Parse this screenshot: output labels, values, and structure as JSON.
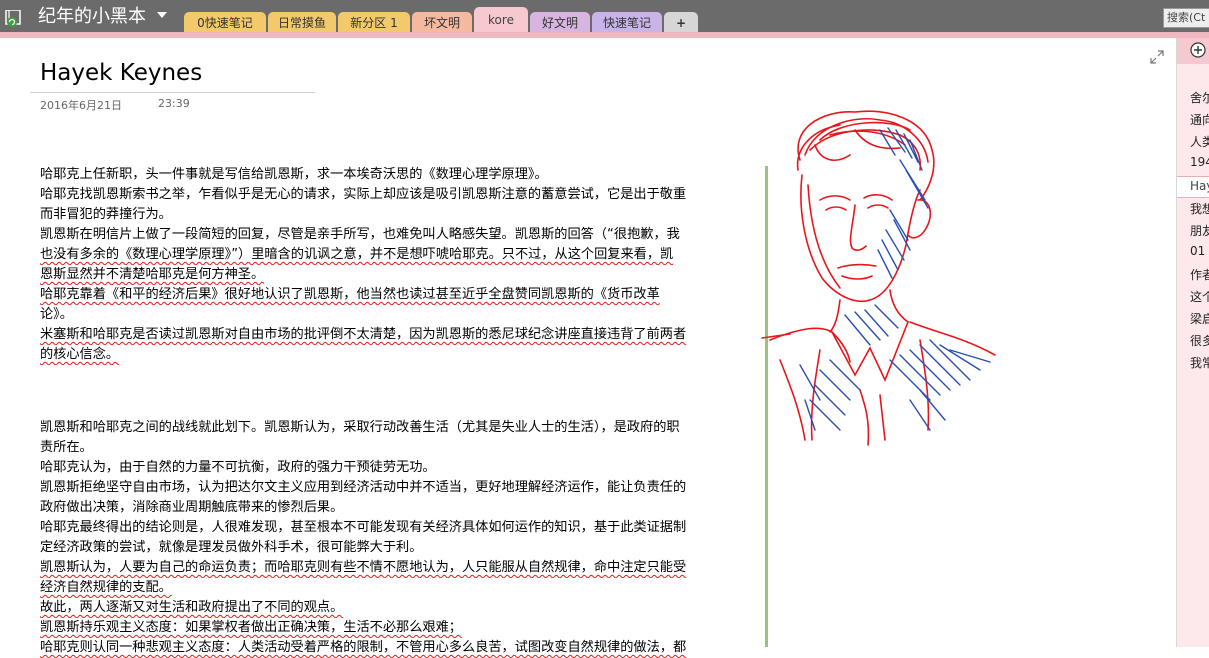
{
  "notebook": {
    "title": "纪年的小黑本"
  },
  "tabs": [
    {
      "label": "0快速笔记",
      "color": "#f2c96b"
    },
    {
      "label": "日常摸鱼",
      "color": "#f2c96b"
    },
    {
      "label": "新分区 1",
      "color": "#f2c96b"
    },
    {
      "label": "坏文明",
      "color": "#f5b9a0"
    },
    {
      "label": "kore",
      "color": "#f5c9cf",
      "active": true
    },
    {
      "label": "好文明",
      "color": "#d8b4e0"
    },
    {
      "label": "快速笔记",
      "color": "#c8b4e6"
    },
    {
      "label": "+",
      "color": "#d6d6d6"
    }
  ],
  "search": {
    "placeholder": "搜索(Ct"
  },
  "page": {
    "title": "Hayek Keynes",
    "date": "2016年6月21日",
    "time": "23:39"
  },
  "content": [
    {
      "text": "哈耶克上任新职，头一件事就是写信给凯恩斯，求一本埃奇沃思的《数理心理学原理》。",
      "squiggle": false
    },
    {
      "text": "哈耶克找凯恩斯索书之举，乍看似乎是无心的请求，实际上却应该是吸引凯恩斯注意的蓄意尝试，它是出于敬重",
      "squiggle": false
    },
    {
      "text": "而非冒犯的莽撞行为。",
      "squiggle": false
    },
    {
      "text": "凯恩斯在明信片上做了一段简短的回复，尽管是亲手所写，也难免叫人略感失望。凯恩斯的回答（“很抱歉，我",
      "squiggle": false
    },
    {
      "text": "也没有多余的《数理心理学原理》”）里暗含的讥讽之意，并不是想吓唬哈耶克。只不过，从这个回复来看，凯",
      "squiggle": true
    },
    {
      "text": "恩斯显然并不清楚哈耶克是何方神圣。",
      "squiggle": true
    },
    {
      "text": "哈耶克靠着《和平的经济后果》很好地认识了凯恩斯，他当然也读过甚至近乎全盘赞同凯恩斯的《货币改革",
      "squiggle": true
    },
    {
      "text": "论》。",
      "squiggle": false
    },
    {
      "text": "米塞斯和哈耶克是否读过凯恩斯对自由市场的批评倒不太清楚，因为凯恩斯的悉尼球纪念讲座直接违背了前两者",
      "squiggle": true
    },
    {
      "text": "的核心信念。",
      "squiggle": true
    },
    {
      "text": "凯恩斯和哈耶克之间的战线就此划下。凯恩斯认为，采取行动改善生活（尤其是失业人士的生活），是政府的职",
      "squiggle": false
    },
    {
      "text": "责所在。",
      "squiggle": false
    },
    {
      "text": "哈耶克认为，由于自然的力量不可抗衡，政府的强力干预徒劳无功。",
      "squiggle": false
    },
    {
      "text": "凯恩斯拒绝坚守自由市场，认为把达尔文主义应用到经济活动中并不适当，更好地理解经济运作，能让负责任的",
      "squiggle": false
    },
    {
      "text": "政府做出决策，消除商业周期触底带来的惨烈后果。",
      "squiggle": false
    },
    {
      "text": "哈耶克最终得出的结论则是，人很难发现，甚至根本不可能发现有关经济具体如何运作的知识，基于此类证据制",
      "squiggle": false
    },
    {
      "text": "定经济政策的尝试，就像是理发员做外科手术，很可能弊大于利。",
      "squiggle": false
    },
    {
      "text": "凯恩斯认为，人要为自己的命运负责；而哈耶克则有些不情不愿地认为，人只能服从自然规律，命中注定只能受",
      "squiggle": true
    },
    {
      "text": "经济自然规律的支配。",
      "squiggle": true
    },
    {
      "text": "故此，两人逐渐又对生活和政府提出了不同的观点。",
      "squiggle": true
    },
    {
      "text": "凯恩斯持乐观主义态度：如果掌权者做出正确决策，生活不必那么艰难；",
      "squiggle": true
    },
    {
      "text": "哈耶克则认同一种悲观主义态度：人类活动受着严格的限制，不管用心多么良苦，试图改变自然规律的做法，都",
      "squiggle": true
    }
  ],
  "page_list": {
    "group1": [
      "舍尔",
      "通向",
      "人类",
      "194"
    ],
    "current": "Hay",
    "group2": [
      "我想",
      "朋友",
      "01",
      "作者",
      "这个",
      "梁启",
      "很多",
      "我常"
    ]
  },
  "sketch": {
    "description_icon": "portrait-sketch",
    "colors": [
      "#e8161c",
      "#2a4fb0"
    ]
  }
}
